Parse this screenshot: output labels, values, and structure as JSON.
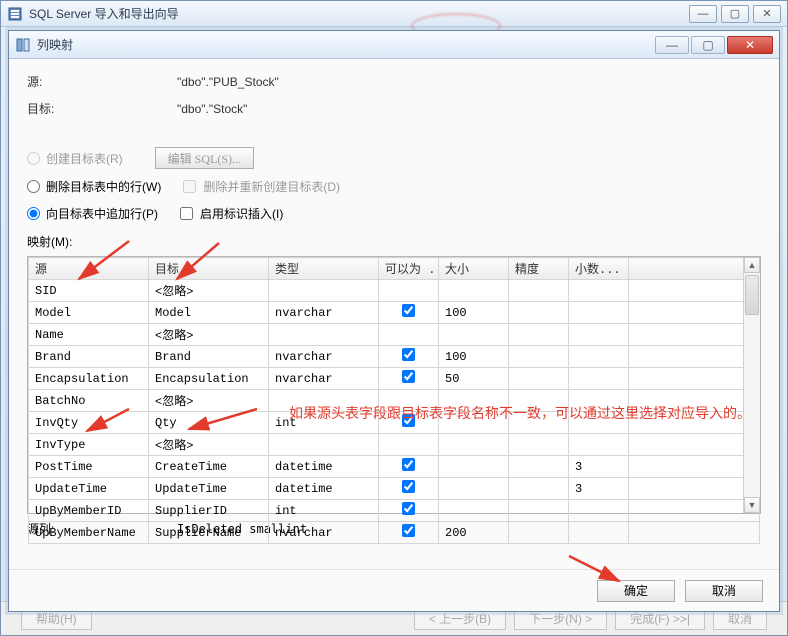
{
  "outer": {
    "title": "SQL Server 导入和导出向导",
    "buttons": {
      "help": "帮助(H)",
      "back": "< 上一步(B)",
      "next": "下一步(N) >",
      "finish": "完成(F) >>|",
      "cancel": "取消"
    }
  },
  "dialog": {
    "title": "列映射",
    "source_label": "源:",
    "source_value": "\"dbo\".\"PUB_Stock\"",
    "dest_label": "目标:",
    "dest_value": "\"dbo\".\"Stock\"",
    "opt_create_label": "创建目标表(R)",
    "edit_sql_btn": "编辑 SQL(S)...",
    "opt_delete_label": "删除目标表中的行(W)",
    "chk_drop_label": "删除并重新创建目标表(D)",
    "opt_append_label": "向目标表中追加行(P)",
    "chk_identity_label": "启用标识插入(I)",
    "mappings_label": "映射(M):",
    "headers": {
      "src": "源",
      "dst": "目标",
      "type": "类型",
      "nullable": "可以为 ...",
      "size": "大小",
      "precision": "精度",
      "scale": "小数..."
    },
    "ignore_text": "<忽略>",
    "rows": [
      {
        "src": "SID",
        "dst": "<忽略>",
        "type": "",
        "nullable": null,
        "size": "",
        "prec": "",
        "scale": ""
      },
      {
        "src": "Model",
        "dst": "Model",
        "type": "nvarchar",
        "nullable": true,
        "size": "100",
        "prec": "",
        "scale": ""
      },
      {
        "src": "Name",
        "dst": "<忽略>",
        "type": "",
        "nullable": null,
        "size": "",
        "prec": "",
        "scale": ""
      },
      {
        "src": "Brand",
        "dst": "Brand",
        "type": "nvarchar",
        "nullable": true,
        "size": "100",
        "prec": "",
        "scale": ""
      },
      {
        "src": "Encapsulation",
        "dst": "Encapsulation",
        "type": "nvarchar",
        "nullable": true,
        "size": "50",
        "prec": "",
        "scale": ""
      },
      {
        "src": "BatchNo",
        "dst": "<忽略>",
        "type": "",
        "nullable": null,
        "size": "",
        "prec": "",
        "scale": ""
      },
      {
        "src": "InvQty",
        "dst": "Qty",
        "type": "int",
        "nullable": true,
        "size": "",
        "prec": "",
        "scale": ""
      },
      {
        "src": "InvType",
        "dst": "<忽略>",
        "type": "",
        "nullable": null,
        "size": "",
        "prec": "",
        "scale": ""
      },
      {
        "src": "PostTime",
        "dst": "CreateTime",
        "type": "datetime",
        "nullable": true,
        "size": "",
        "prec": "",
        "scale": "3"
      },
      {
        "src": "UpdateTime",
        "dst": "UpdateTime",
        "type": "datetime",
        "nullable": true,
        "size": "",
        "prec": "",
        "scale": "3"
      },
      {
        "src": "UpByMemberID",
        "dst": "SupplierID",
        "type": "int",
        "nullable": true,
        "size": "",
        "prec": "",
        "scale": ""
      },
      {
        "src": "UpByMemberName",
        "dst": "SupplierName",
        "type": "nvarchar",
        "nullable": true,
        "size": "200",
        "prec": "",
        "scale": ""
      }
    ],
    "source_column_label": "源列:",
    "source_column_value": "IsDeleted smallint",
    "ok_btn": "确定",
    "cancel_btn": "取消"
  },
  "annotation": {
    "text": "如果源头表字段跟目标表字段名称不一致，可以通过这里选择对应导入的。"
  }
}
